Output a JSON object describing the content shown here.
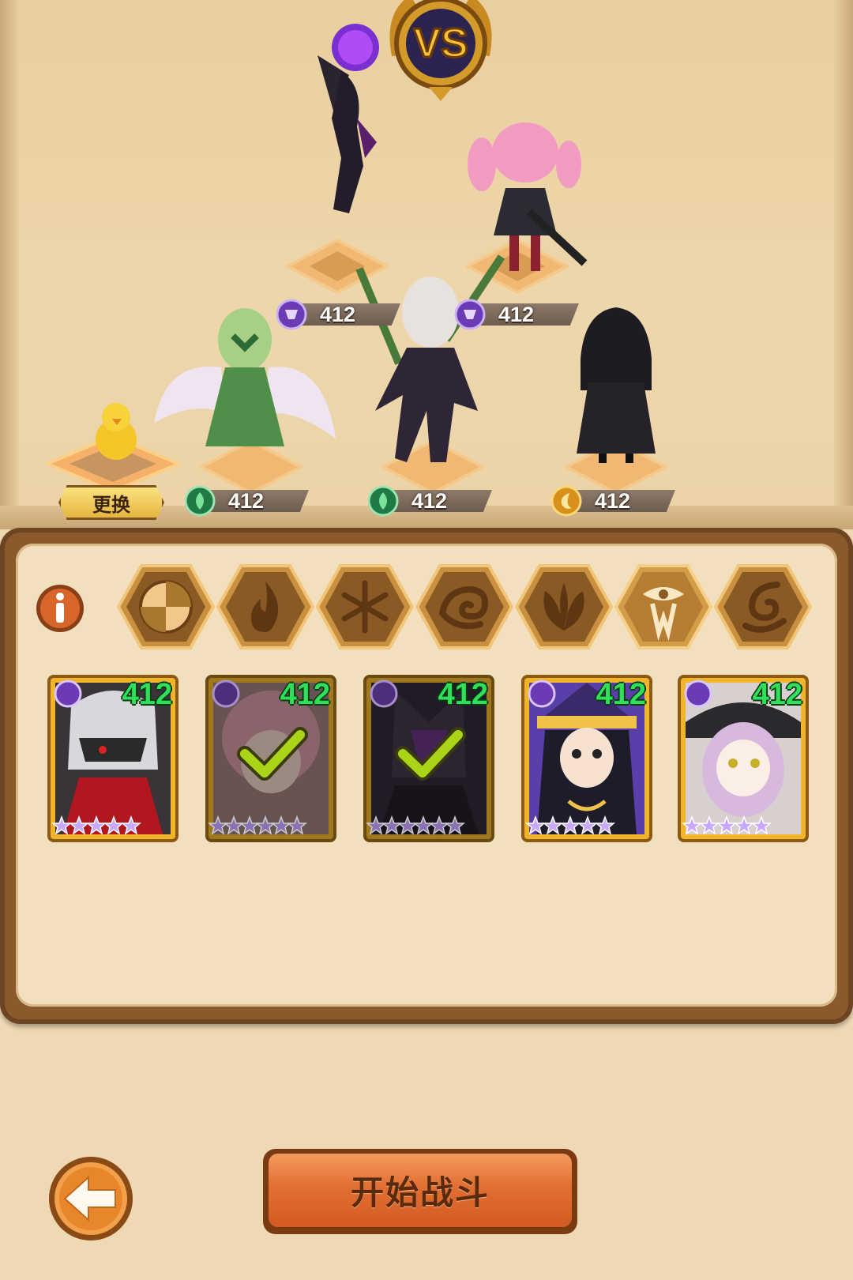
{
  "battlefield": {
    "vs_label": "VS",
    "swap_label": "更换",
    "units": [
      {
        "element": "light-dark",
        "power": "412"
      },
      {
        "element": "light-dark",
        "power": "412"
      },
      {
        "element": "wood",
        "power": "412"
      },
      {
        "element": "wood",
        "power": "412"
      },
      {
        "element": "gold",
        "power": "412"
      }
    ]
  },
  "panel": {
    "info_icon": "info-icon",
    "element_tabs": [
      {
        "name": "all",
        "icon": "all-elements-icon",
        "selected": true
      },
      {
        "name": "fire",
        "icon": "fire-icon"
      },
      {
        "name": "ice",
        "icon": "snowflake-icon"
      },
      {
        "name": "wind",
        "icon": "wind-icon"
      },
      {
        "name": "wood",
        "icon": "leaf-icon"
      },
      {
        "name": "light-dark",
        "icon": "eye-icon",
        "highlighted": true
      },
      {
        "name": "gold",
        "icon": "moon-swirl-icon"
      }
    ],
    "heroes": [
      {
        "power": "412",
        "stars": 5,
        "deployed": false
      },
      {
        "power": "412",
        "stars": 6,
        "deployed": true
      },
      {
        "power": "412",
        "stars": 6,
        "deployed": true
      },
      {
        "power": "412",
        "stars": 5,
        "deployed": false
      },
      {
        "power": "412",
        "stars": 5,
        "deployed": false
      }
    ]
  },
  "footer": {
    "back_icon": "back-arrow-icon",
    "start_label": "开始战斗"
  },
  "colors": {
    "background": "#efd9b4",
    "panel_frame": "#8a5a2d",
    "power_text": "#2fe05a",
    "start_button": "#e26f33"
  }
}
